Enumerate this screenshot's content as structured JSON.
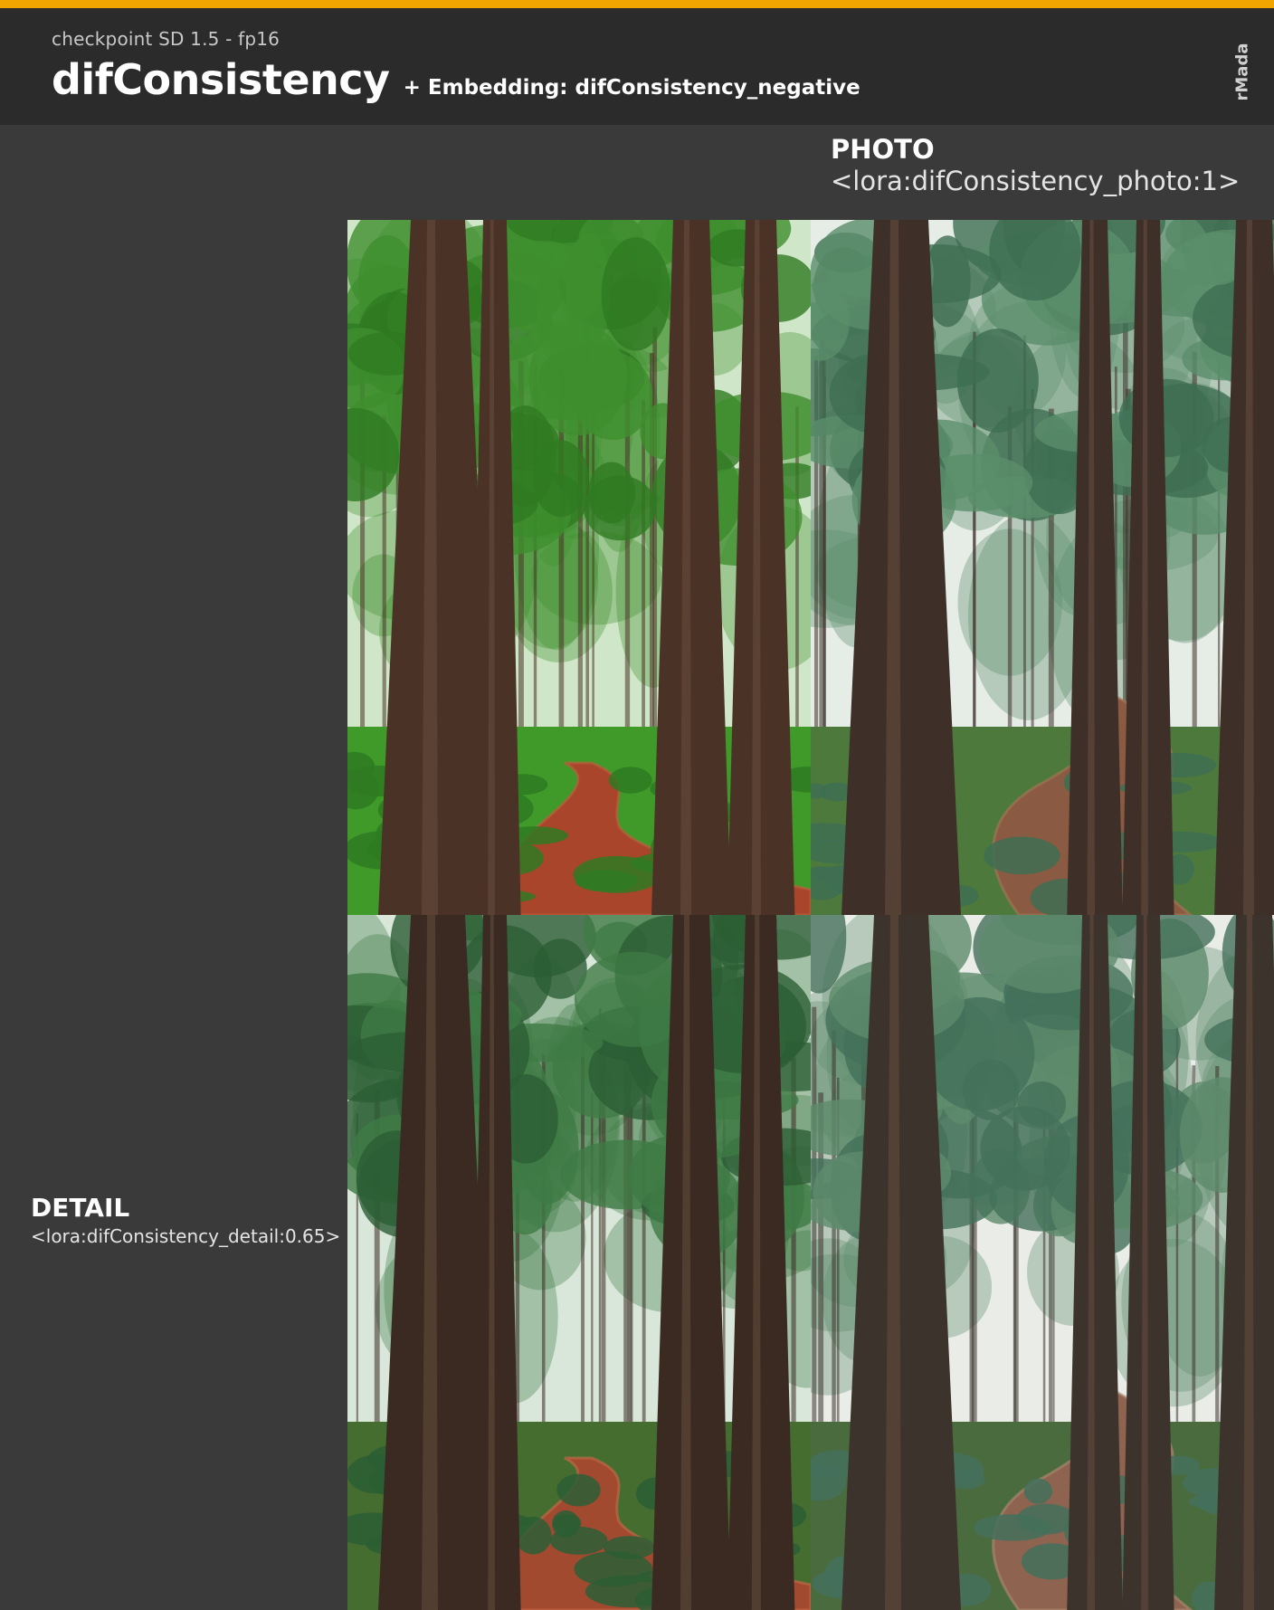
{
  "header": {
    "subtitle": "checkpoint SD 1.5 - fp16",
    "title": "difConsistency",
    "embedding": "+ Embedding: difConsistency_negative",
    "author": "rMada"
  },
  "columns": [
    {
      "label": "PHOTO",
      "tag": "<lora:difConsistency_photo:1>"
    }
  ],
  "rows": [
    {
      "label": "DETAIL",
      "tag": "<lora:difConsistency_detail:0.65>"
    }
  ],
  "colors": {
    "accent": "#f0a500",
    "header_bg": "#2b2b2c",
    "page_bg": "#3a3a3b"
  },
  "images": [
    {
      "id": "base",
      "description_icon": "forest-image"
    },
    {
      "id": "photo",
      "description_icon": "forest-image"
    },
    {
      "id": "detail",
      "description_icon": "forest-image"
    },
    {
      "id": "photo-detail",
      "description_icon": "forest-image"
    }
  ]
}
